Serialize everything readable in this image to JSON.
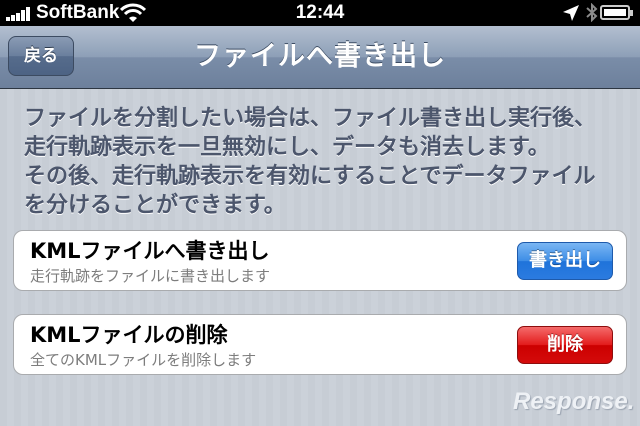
{
  "status_bar": {
    "carrier": "SoftBank",
    "time": "12:44",
    "icons": [
      "signal-bars-icon",
      "wifi-icon",
      "location-arrow-icon",
      "bluetooth-icon",
      "battery-icon"
    ]
  },
  "nav": {
    "back_label": "戻る",
    "title": "ファイルへ書き出し"
  },
  "description": {
    "lines": [
      "ファイルを分割したい場合は、ファイル書き出し実行後、",
      "走行軌跡表示を一旦無効にし、データも消去します。",
      "その後、走行軌跡表示を有効にすることでデータファイル",
      "を分けることができます。"
    ]
  },
  "export_row": {
    "title": "KMLファイルへ書き出し",
    "subtitle": "走行軌跡をファイルに書き出します",
    "button_label": "書き出し",
    "button_color": "#2b7be0"
  },
  "delete_row": {
    "title": "KMLファイルの削除",
    "subtitle": "全てのKMLファイルを削除します",
    "button_label": "削除",
    "button_color": "#d40b0b"
  },
  "watermark": "Response."
}
